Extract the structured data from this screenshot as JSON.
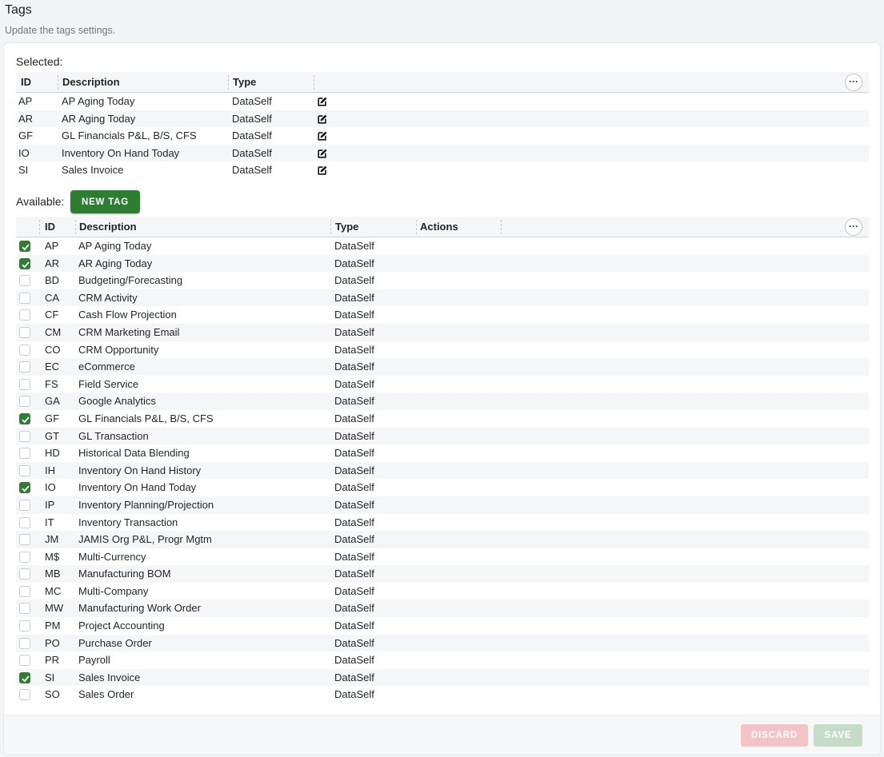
{
  "page": {
    "title": "Tags",
    "subtitle": "Update the tags settings."
  },
  "selected": {
    "label": "Selected:",
    "columns": {
      "id": "ID",
      "description": "Description",
      "type": "Type"
    },
    "rows": [
      {
        "id": "AP",
        "description": "AP Aging Today",
        "type": "DataSelf"
      },
      {
        "id": "AR",
        "description": "AR Aging Today",
        "type": "DataSelf"
      },
      {
        "id": "GF",
        "description": "GL Financials P&L, B/S, CFS",
        "type": "DataSelf"
      },
      {
        "id": "IO",
        "description": "Inventory On Hand Today",
        "type": "DataSelf"
      },
      {
        "id": "SI",
        "description": "Sales Invoice",
        "type": "DataSelf"
      }
    ]
  },
  "available": {
    "label": "Available:",
    "new_tag_label": "NEW TAG",
    "columns": {
      "id": "ID",
      "description": "Description",
      "type": "Type",
      "actions": "Actions"
    },
    "rows": [
      {
        "checked": true,
        "id": "AP",
        "description": "AP Aging Today",
        "type": "DataSelf"
      },
      {
        "checked": true,
        "id": "AR",
        "description": "AR Aging Today",
        "type": "DataSelf"
      },
      {
        "checked": false,
        "id": "BD",
        "description": "Budgeting/Forecasting",
        "type": "DataSelf"
      },
      {
        "checked": false,
        "id": "CA",
        "description": "CRM Activity",
        "type": "DataSelf"
      },
      {
        "checked": false,
        "id": "CF",
        "description": "Cash Flow Projection",
        "type": "DataSelf"
      },
      {
        "checked": false,
        "id": "CM",
        "description": "CRM Marketing Email",
        "type": "DataSelf"
      },
      {
        "checked": false,
        "id": "CO",
        "description": "CRM Opportunity",
        "type": "DataSelf"
      },
      {
        "checked": false,
        "id": "EC",
        "description": "eCommerce",
        "type": "DataSelf"
      },
      {
        "checked": false,
        "id": "FS",
        "description": "Field Service",
        "type": "DataSelf"
      },
      {
        "checked": false,
        "id": "GA",
        "description": "Google Analytics",
        "type": "DataSelf"
      },
      {
        "checked": true,
        "id": "GF",
        "description": "GL Financials P&L, B/S, CFS",
        "type": "DataSelf"
      },
      {
        "checked": false,
        "id": "GT",
        "description": "GL Transaction",
        "type": "DataSelf"
      },
      {
        "checked": false,
        "id": "HD",
        "description": "Historical Data Blending",
        "type": "DataSelf"
      },
      {
        "checked": false,
        "id": "IH",
        "description": "Inventory On Hand History",
        "type": "DataSelf"
      },
      {
        "checked": true,
        "id": "IO",
        "description": "Inventory On Hand Today",
        "type": "DataSelf"
      },
      {
        "checked": false,
        "id": "IP",
        "description": "Inventory Planning/Projection",
        "type": "DataSelf"
      },
      {
        "checked": false,
        "id": "IT",
        "description": "Inventory Transaction",
        "type": "DataSelf"
      },
      {
        "checked": false,
        "id": "JM",
        "description": "JAMIS Org P&L, Progr Mgtm",
        "type": "DataSelf"
      },
      {
        "checked": false,
        "id": "M$",
        "description": "Multi-Currency",
        "type": "DataSelf"
      },
      {
        "checked": false,
        "id": "MB",
        "description": "Manufacturing BOM",
        "type": "DataSelf"
      },
      {
        "checked": false,
        "id": "MC",
        "description": "Multi-Company",
        "type": "DataSelf"
      },
      {
        "checked": false,
        "id": "MW",
        "description": "Manufacturing Work Order",
        "type": "DataSelf"
      },
      {
        "checked": false,
        "id": "PM",
        "description": "Project Accounting",
        "type": "DataSelf"
      },
      {
        "checked": false,
        "id": "PO",
        "description": "Purchase Order",
        "type": "DataSelf"
      },
      {
        "checked": false,
        "id": "PR",
        "description": "Payroll",
        "type": "DataSelf"
      },
      {
        "checked": true,
        "id": "SI",
        "description": "Sales Invoice",
        "type": "DataSelf"
      },
      {
        "checked": false,
        "id": "SO",
        "description": "Sales Order",
        "type": "DataSelf"
      }
    ]
  },
  "footer": {
    "discard_label": "DISCARD",
    "save_label": "SAVE"
  },
  "colors": {
    "accent": "#2e7d32",
    "discard": "#f4c3c6",
    "save": "#c5ddc7"
  },
  "icons": {
    "edit": "edit-icon",
    "more": "more-options-icon",
    "check": "checkmark-icon"
  }
}
